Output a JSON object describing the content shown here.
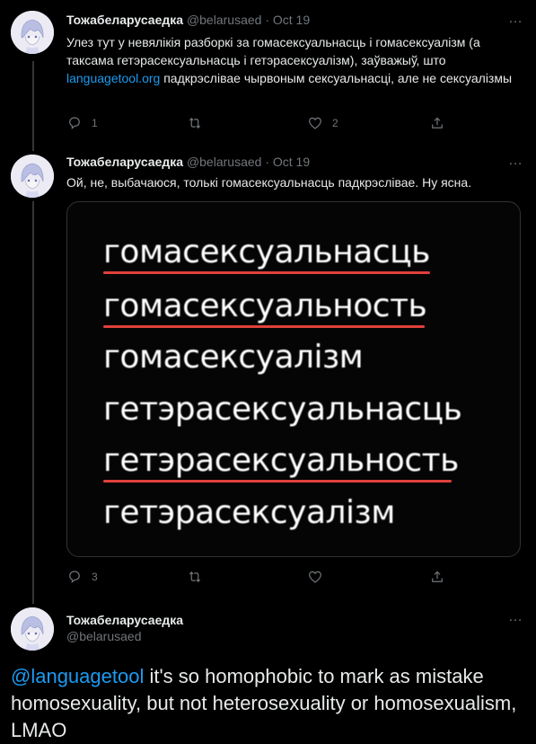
{
  "tweets": [
    {
      "author_name": "Тожабеларусаедка",
      "handle": "@belarusaed",
      "separator": "·",
      "time": "Oct 19",
      "text_before_link": "Улез тут у невялікія разборкі за гомасексуальнасць і гомасексуалізм (а таксама гетэрасексуальнасць і гетэрасексуалізм), заўважыў, што ",
      "link_text": "languagetool.org",
      "text_after_link": " падкрэслівае чырвоным сексуальнасці, але не сексуалізмы",
      "replies": "1",
      "retweets": "",
      "likes": "2"
    },
    {
      "author_name": "Тожабеларусаедка",
      "handle": "@belarusaed",
      "separator": "·",
      "time": "Oct 19",
      "text": "Ой, не, выбачаюся, толькі гомасексуальнасць падкрэслівае. Ну ясна.",
      "media_words": [
        "гомасексуальнасць",
        "гомасексуальность",
        "гомасексуалізм",
        "гетэрасексуальнасць",
        "гетэрасексуальность",
        "гетэрасексуалізм"
      ],
      "media_underlined": [
        true,
        true,
        false,
        false,
        true,
        false
      ],
      "replies": "3",
      "retweets": "",
      "likes": ""
    },
    {
      "author_name": "Тожабеларусаедка",
      "handle": "@belarusaed",
      "mention": "@languagetool",
      "text": " it's so homophobic to mark as mistake homosexuality, but not heterosexuality or homosexualism, LMAO"
    }
  ],
  "more_icon": "…",
  "colors": {
    "background": "#000000",
    "text": "#e7e9ea",
    "muted": "#71767b",
    "link": "#1d9bf0",
    "spell_underline": "#e0403a",
    "divider": "#2f3336"
  },
  "icons": [
    "reply-icon",
    "retweet-icon",
    "like-icon",
    "share-icon",
    "more-icon"
  ]
}
